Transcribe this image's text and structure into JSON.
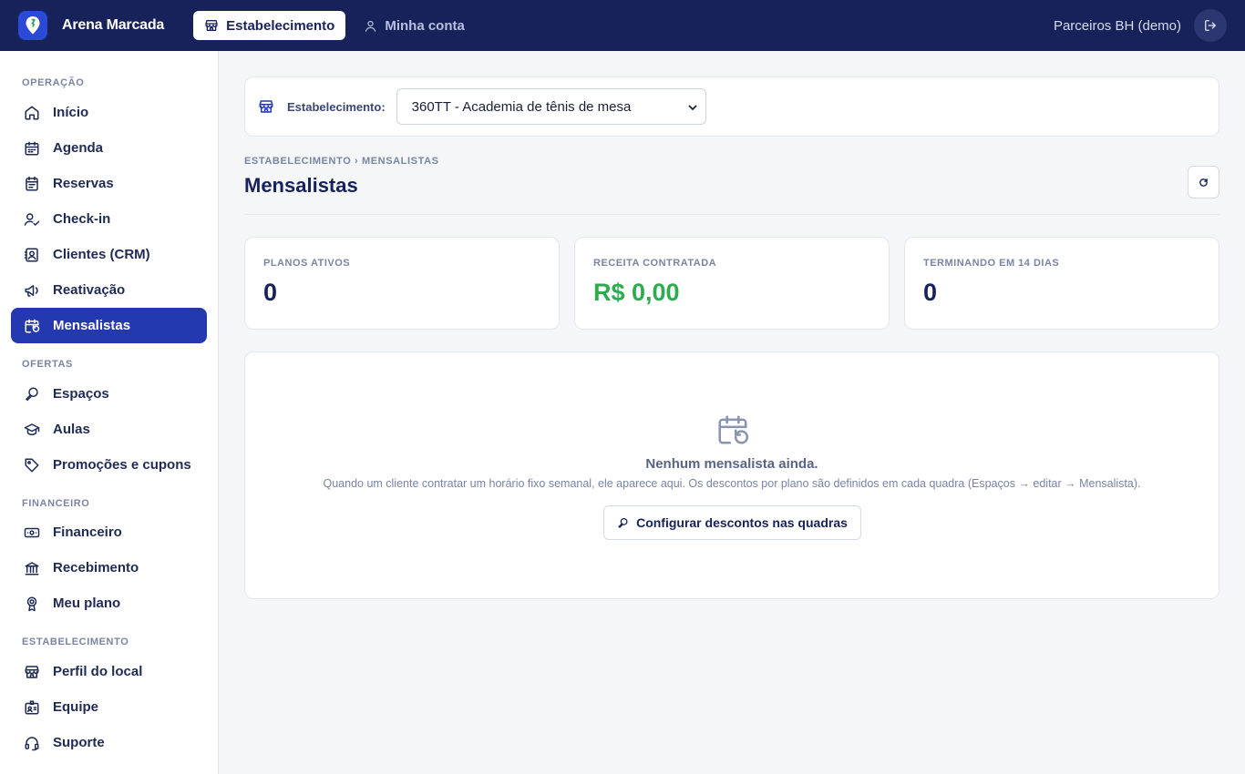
{
  "app": {
    "name": "Arena Marcada"
  },
  "topnav": {
    "tabs": [
      {
        "label": "Estabelecimento",
        "icon": "store-icon",
        "active": true
      },
      {
        "label": "Minha conta",
        "icon": "user-icon",
        "active": false
      }
    ],
    "user": "Parceiros BH (demo)",
    "logout_icon": "logout-icon"
  },
  "sidebar": {
    "sections": [
      {
        "title": "OPERAÇÃO",
        "items": [
          {
            "label": "Início",
            "icon": "home-icon"
          },
          {
            "label": "Agenda",
            "icon": "calendar-icon"
          },
          {
            "label": "Reservas",
            "icon": "clipboard-icon"
          },
          {
            "label": "Check-in",
            "icon": "user-check-icon"
          },
          {
            "label": "Clientes (CRM)",
            "icon": "contact-icon"
          },
          {
            "label": "Reativação",
            "icon": "megaphone-icon"
          },
          {
            "label": "Mensalistas",
            "icon": "calendar-repeat-icon",
            "active": true
          }
        ]
      },
      {
        "title": "OFERTAS",
        "items": [
          {
            "label": "Espaços",
            "icon": "racket-icon"
          },
          {
            "label": "Aulas",
            "icon": "graduation-cap-icon"
          },
          {
            "label": "Promoções e cupons",
            "icon": "tag-icon"
          }
        ]
      },
      {
        "title": "FINANCEIRO",
        "items": [
          {
            "label": "Financeiro",
            "icon": "banknote-icon"
          },
          {
            "label": "Recebimento",
            "icon": "bank-icon"
          },
          {
            "label": "Meu plano",
            "icon": "badge-icon"
          }
        ]
      },
      {
        "title": "ESTABELECIMENTO",
        "items": [
          {
            "label": "Perfil do local",
            "icon": "store-icon"
          },
          {
            "label": "Equipe",
            "icon": "id-card-icon"
          },
          {
            "label": "Suporte",
            "icon": "headset-icon"
          }
        ]
      }
    ]
  },
  "establishment": {
    "label": "Estabelecimento:",
    "selected": "360TT - Academia de tênis de mesa"
  },
  "page": {
    "breadcrumb": "ESTABELECIMENTO › MENSALISTAS",
    "title": "Mensalistas"
  },
  "stats": [
    {
      "label": "PLANOS ATIVOS",
      "value": "0"
    },
    {
      "label": "RECEITA CONTRATADA",
      "value": "R$ 0,00"
    },
    {
      "label": "TERMINANDO EM 14 DIAS",
      "value": "0"
    }
  ],
  "empty": {
    "title": "Nenhum mensalista ainda.",
    "description": "Quando um cliente contratar um horário fixo semanal, ele aparece aqui. Os descontos por plano são definidos em cada quadra (Espaços → editar → Mensalista).",
    "button": "Configurar descontos nas quadras"
  },
  "colors": {
    "topbar": "#17225a",
    "active_nav": "#2438b0",
    "revenue": "#2eaa4f"
  }
}
